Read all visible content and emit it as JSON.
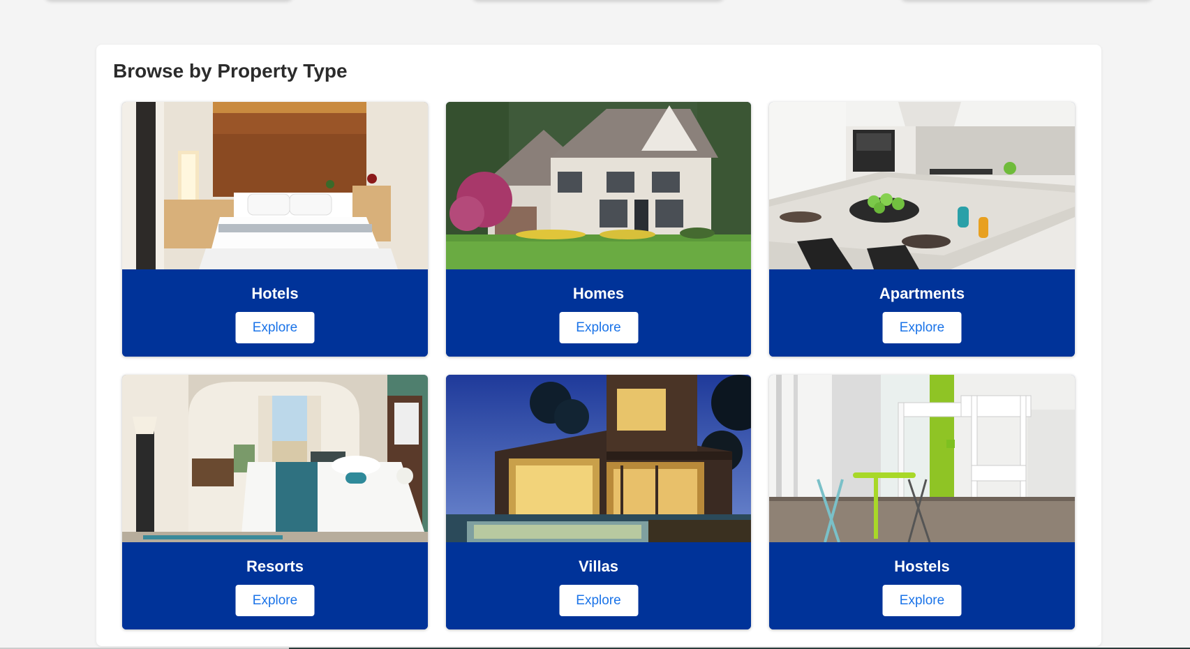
{
  "section": {
    "title": "Browse by Property Type"
  },
  "colors": {
    "card_footer": "#003399",
    "button_text": "#1a73e8",
    "page_background": "#f4f4f4"
  },
  "property_types": [
    {
      "label": "Hotels",
      "button": "Explore",
      "image": "hotel-room-photo"
    },
    {
      "label": "Homes",
      "button": "Explore",
      "image": "house-photo"
    },
    {
      "label": "Apartments",
      "button": "Explore",
      "image": "kitchen-photo"
    },
    {
      "label": "Resorts",
      "button": "Explore",
      "image": "resort-room-photo"
    },
    {
      "label": "Villas",
      "button": "Explore",
      "image": "villa-night-photo"
    },
    {
      "label": "Hostels",
      "button": "Explore",
      "image": "bunk-beds-photo"
    }
  ]
}
